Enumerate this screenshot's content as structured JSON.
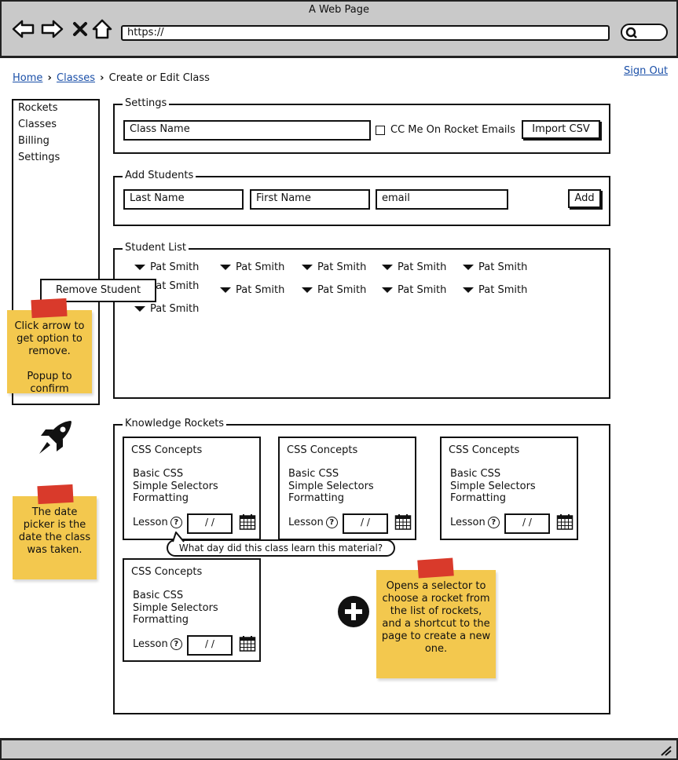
{
  "browser": {
    "title": "A Web Page",
    "url": "https://"
  },
  "header": {
    "breadcrumb": {
      "home": "Home",
      "classes": "Classes",
      "current": "Create or Edit Class"
    },
    "sign_out": "Sign Out"
  },
  "sidebar": {
    "items": [
      {
        "label": "Rockets"
      },
      {
        "label": "Classes"
      },
      {
        "label": "Billing"
      },
      {
        "label": "Settings"
      }
    ]
  },
  "settings": {
    "legend": "Settings",
    "class_name_placeholder": "Class Name",
    "cc_label": "CC Me On Rocket Emails",
    "import_label": "Import CSV"
  },
  "add_students": {
    "legend": "Add Students",
    "last_name": "Last Name",
    "first_name": "First Name",
    "email": "email",
    "add_label": "Add"
  },
  "student_list": {
    "legend": "Student List",
    "students": [
      "Pat Smith",
      "Pat Smith",
      "Pat Smith",
      "Pat Smith",
      "Pat Smith",
      "Pat Smith",
      "Pat Smith",
      "Pat Smith",
      "Pat Smith",
      "Pat Smith",
      "Pat Smith"
    ],
    "popup": "Remove Student"
  },
  "knowledge_rockets": {
    "legend": "Knowledge Rockets",
    "cards": [
      {
        "title": "CSS Concepts",
        "topics": [
          "Basic CSS",
          "Simple Selectors",
          "Formatting"
        ],
        "lesson": "Lesson",
        "date": "/ /"
      },
      {
        "title": "CSS Concepts",
        "topics": [
          "Basic CSS",
          "Simple Selectors",
          "Formatting"
        ],
        "lesson": "Lesson",
        "date": "/ /"
      },
      {
        "title": "CSS Concepts",
        "topics": [
          "Basic CSS",
          "Simple Selectors",
          "Formatting"
        ],
        "lesson": "Lesson",
        "date": "/ /"
      },
      {
        "title": "CSS Concepts",
        "topics": [
          "Basic CSS",
          "Simple Selectors",
          "Formatting"
        ],
        "lesson": "Lesson",
        "date": "/ /"
      }
    ],
    "tooltip": "What day did this class learn this material?"
  },
  "notes": {
    "arrow_note": [
      "Click arrow to",
      "get option to",
      "remove.",
      "",
      "Popup to",
      "confirm"
    ],
    "date_note": [
      "The date",
      "picker is the",
      "date the class",
      "was taken."
    ],
    "add_note": [
      "Opens a selector to",
      "choose a rocket from",
      "the list of rockets,",
      "and a shortcut to the",
      "page to create a new",
      "one."
    ]
  },
  "colors": {
    "sticky": "#f3c84e",
    "tape": "#d93a2b",
    "link": "#1a4fa8",
    "chrome": "#c9c9c9"
  },
  "icons": [
    "back-icon",
    "forward-icon",
    "close-icon",
    "home-icon",
    "search-icon",
    "rocket-icon",
    "calendar-icon",
    "help-icon",
    "plus-icon",
    "resize-icon"
  ]
}
